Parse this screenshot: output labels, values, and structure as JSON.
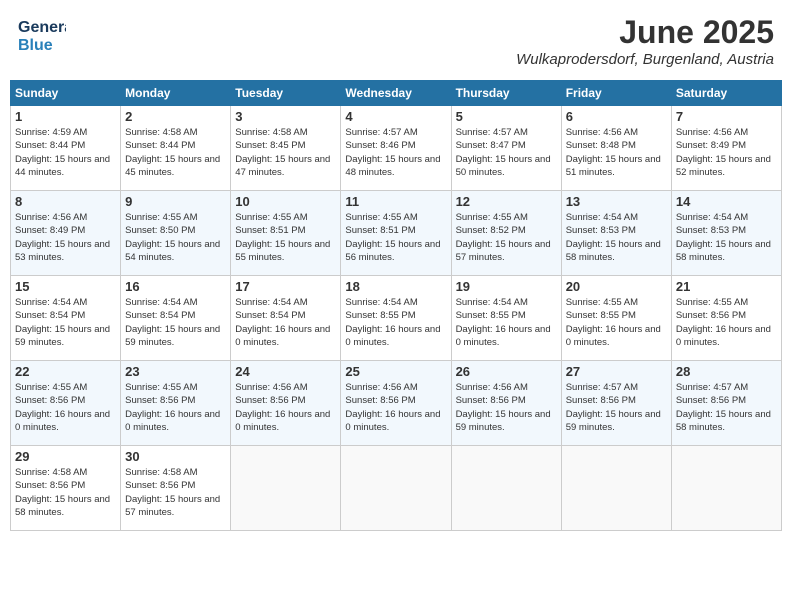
{
  "header": {
    "logo_general": "General",
    "logo_blue": "Blue",
    "month": "June 2025",
    "location": "Wulkaprodersdorf, Burgenland, Austria"
  },
  "weekdays": [
    "Sunday",
    "Monday",
    "Tuesday",
    "Wednesday",
    "Thursday",
    "Friday",
    "Saturday"
  ],
  "weeks": [
    [
      {
        "day": "1",
        "sunrise": "4:59 AM",
        "sunset": "8:44 PM",
        "daylight": "15 hours and 44 minutes."
      },
      {
        "day": "2",
        "sunrise": "4:58 AM",
        "sunset": "8:44 PM",
        "daylight": "15 hours and 45 minutes."
      },
      {
        "day": "3",
        "sunrise": "4:58 AM",
        "sunset": "8:45 PM",
        "daylight": "15 hours and 47 minutes."
      },
      {
        "day": "4",
        "sunrise": "4:57 AM",
        "sunset": "8:46 PM",
        "daylight": "15 hours and 48 minutes."
      },
      {
        "day": "5",
        "sunrise": "4:57 AM",
        "sunset": "8:47 PM",
        "daylight": "15 hours and 50 minutes."
      },
      {
        "day": "6",
        "sunrise": "4:56 AM",
        "sunset": "8:48 PM",
        "daylight": "15 hours and 51 minutes."
      },
      {
        "day": "7",
        "sunrise": "4:56 AM",
        "sunset": "8:49 PM",
        "daylight": "15 hours and 52 minutes."
      }
    ],
    [
      {
        "day": "8",
        "sunrise": "4:56 AM",
        "sunset": "8:49 PM",
        "daylight": "15 hours and 53 minutes."
      },
      {
        "day": "9",
        "sunrise": "4:55 AM",
        "sunset": "8:50 PM",
        "daylight": "15 hours and 54 minutes."
      },
      {
        "day": "10",
        "sunrise": "4:55 AM",
        "sunset": "8:51 PM",
        "daylight": "15 hours and 55 minutes."
      },
      {
        "day": "11",
        "sunrise": "4:55 AM",
        "sunset": "8:51 PM",
        "daylight": "15 hours and 56 minutes."
      },
      {
        "day": "12",
        "sunrise": "4:55 AM",
        "sunset": "8:52 PM",
        "daylight": "15 hours and 57 minutes."
      },
      {
        "day": "13",
        "sunrise": "4:54 AM",
        "sunset": "8:53 PM",
        "daylight": "15 hours and 58 minutes."
      },
      {
        "day": "14",
        "sunrise": "4:54 AM",
        "sunset": "8:53 PM",
        "daylight": "15 hours and 58 minutes."
      }
    ],
    [
      {
        "day": "15",
        "sunrise": "4:54 AM",
        "sunset": "8:54 PM",
        "daylight": "15 hours and 59 minutes."
      },
      {
        "day": "16",
        "sunrise": "4:54 AM",
        "sunset": "8:54 PM",
        "daylight": "15 hours and 59 minutes."
      },
      {
        "day": "17",
        "sunrise": "4:54 AM",
        "sunset": "8:54 PM",
        "daylight": "16 hours and 0 minutes."
      },
      {
        "day": "18",
        "sunrise": "4:54 AM",
        "sunset": "8:55 PM",
        "daylight": "16 hours and 0 minutes."
      },
      {
        "day": "19",
        "sunrise": "4:54 AM",
        "sunset": "8:55 PM",
        "daylight": "16 hours and 0 minutes."
      },
      {
        "day": "20",
        "sunrise": "4:55 AM",
        "sunset": "8:55 PM",
        "daylight": "16 hours and 0 minutes."
      },
      {
        "day": "21",
        "sunrise": "4:55 AM",
        "sunset": "8:56 PM",
        "daylight": "16 hours and 0 minutes."
      }
    ],
    [
      {
        "day": "22",
        "sunrise": "4:55 AM",
        "sunset": "8:56 PM",
        "daylight": "16 hours and 0 minutes."
      },
      {
        "day": "23",
        "sunrise": "4:55 AM",
        "sunset": "8:56 PM",
        "daylight": "16 hours and 0 minutes."
      },
      {
        "day": "24",
        "sunrise": "4:56 AM",
        "sunset": "8:56 PM",
        "daylight": "16 hours and 0 minutes."
      },
      {
        "day": "25",
        "sunrise": "4:56 AM",
        "sunset": "8:56 PM",
        "daylight": "16 hours and 0 minutes."
      },
      {
        "day": "26",
        "sunrise": "4:56 AM",
        "sunset": "8:56 PM",
        "daylight": "15 hours and 59 minutes."
      },
      {
        "day": "27",
        "sunrise": "4:57 AM",
        "sunset": "8:56 PM",
        "daylight": "15 hours and 59 minutes."
      },
      {
        "day": "28",
        "sunrise": "4:57 AM",
        "sunset": "8:56 PM",
        "daylight": "15 hours and 58 minutes."
      }
    ],
    [
      {
        "day": "29",
        "sunrise": "4:58 AM",
        "sunset": "8:56 PM",
        "daylight": "15 hours and 58 minutes."
      },
      {
        "day": "30",
        "sunrise": "4:58 AM",
        "sunset": "8:56 PM",
        "daylight": "15 hours and 57 minutes."
      },
      null,
      null,
      null,
      null,
      null
    ]
  ]
}
